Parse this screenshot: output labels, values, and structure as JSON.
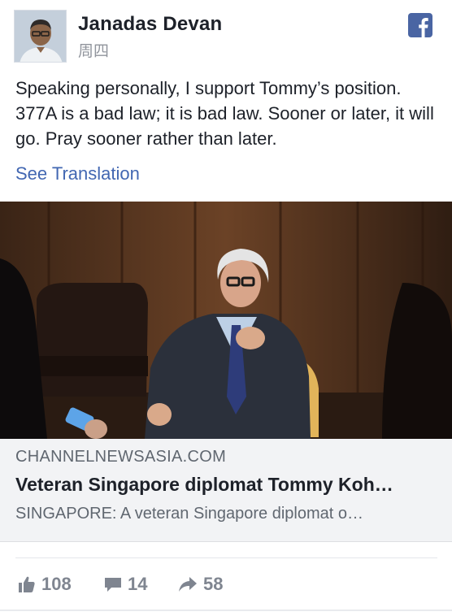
{
  "post": {
    "author": "Janadas Devan",
    "timestamp": "周四",
    "text": "Speaking personally, I support Tommy’s position. 377A is a bad law; it is bad law. Sooner or later, it will go. Pray sooner rather than later.",
    "see_translation": "See Translation"
  },
  "link_preview": {
    "domain": "CHANNELNEWSASIA.COM",
    "title": "Veteran Singapore diplomat Tommy Koh…",
    "description": "SINGAPORE: A veteran Singapore diplomat o…"
  },
  "actions": {
    "likes": "108",
    "comments": "14",
    "shares": "58"
  },
  "icons": {
    "platform": "facebook-icon",
    "like": "thumbs-up-icon",
    "comment": "comment-icon",
    "share": "share-arrow-icon"
  },
  "colors": {
    "link_blue": "#4267b2",
    "text_dark": "#1d2129",
    "meta_gray": "#90949c",
    "preview_bg": "#f2f3f5",
    "action_gray": "#7f8590"
  }
}
